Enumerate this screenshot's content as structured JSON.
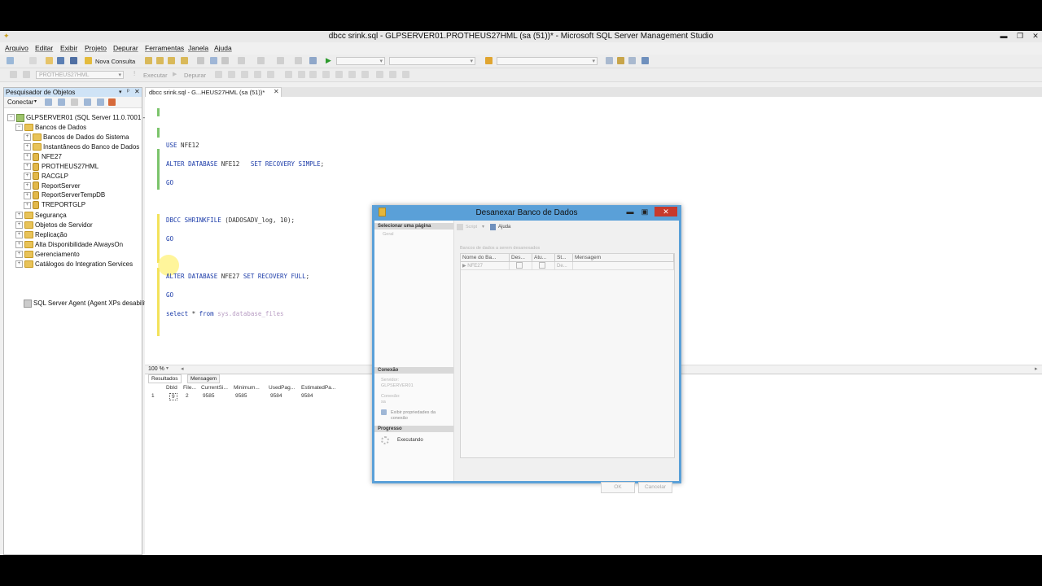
{
  "window": {
    "title": "dbcc srink.sql - GLPSERVER01.PROTHEUS27HML (sa (51))* - Microsoft SQL Server Management Studio"
  },
  "menu": [
    "Arquivo",
    "Editar",
    "Exibir",
    "Projeto",
    "Depurar",
    "Ferramentas",
    "Janela",
    "Ajuda"
  ],
  "toolbar": {
    "new_query": "Nova Consulta",
    "database_combo": "PROTHEUS27HML",
    "execute": "Executar",
    "debug": "Depurar"
  },
  "object_explorer": {
    "title": "Pesquisador de Objetos",
    "connect": "Conectar",
    "server": "GLPSERVER01 (SQL Server 11.0.7001 - sa)",
    "databases_folder": "Bancos de Dados",
    "items": [
      {
        "label": "Bancos de Dados do Sistema",
        "type": "folder"
      },
      {
        "label": "Instantâneos do Banco de Dados",
        "type": "folder"
      },
      {
        "label": "NFE27",
        "type": "db"
      },
      {
        "label": "PROTHEUS27HML",
        "type": "db"
      },
      {
        "label": "RACGLP",
        "type": "db"
      },
      {
        "label": "ReportServer",
        "type": "db"
      },
      {
        "label": "ReportServerTempDB",
        "type": "db"
      },
      {
        "label": "TREPORTGLP",
        "type": "db"
      }
    ],
    "root_items": [
      "Segurança",
      "Objetos de Servidor",
      "Replicação",
      "Alta Disponibilidade AlwaysOn",
      "Gerenciamento",
      "Catálogos do Integration Services"
    ],
    "agent": "SQL Server Agent (Agent XPs desabilit"
  },
  "document_tab": "dbcc srink.sql - G...HEUS27HML (sa (51))*",
  "editor": {
    "lines": {
      "use": [
        "USE",
        " NFE12"
      ],
      "alter1": [
        "ALTER DATABASE",
        " NFE12   ",
        "SET RECOVERY SIMPLE",
        ";"
      ],
      "go1": "GO",
      "dbcc": [
        "DBCC SHRINKFILE",
        " (DADOSADV_log, 10);"
      ],
      "go2": "GO",
      "alter2": [
        "ALTER DATABASE",
        " NFE27 ",
        "SET RECOVERY FULL",
        ";"
      ],
      "go3": "GO",
      "select": [
        "select",
        " * ",
        "from",
        " sys.database_files"
      ]
    }
  },
  "zoom": "100 %",
  "results": {
    "tabs": [
      "Resultados",
      "Mensagem"
    ],
    "columns": [
      "DbId",
      "File...",
      "CurrentSi...",
      "Minimum...",
      "UsedPag...",
      "EstimatedPa..."
    ],
    "rows": [
      [
        "1",
        "9",
        "2",
        "9585",
        "9585",
        "9584",
        "9584"
      ]
    ]
  },
  "dialog": {
    "title": "Desanexar Banco de Dados",
    "select_page": "Selecionar uma página",
    "page_general": "Geral",
    "script": "Script",
    "help": "Ajuda",
    "grid_caption": "Bancos de dados a serem desanexados",
    "grid_columns": [
      "Nome do Ba...",
      "Des...",
      "Atu...",
      "St...",
      "Mensagem"
    ],
    "grid_row": {
      "name": "NFE27",
      "status": "De..."
    },
    "connection_section": "Conexão",
    "server_label": "Servidor:",
    "server_value": "GLPSERVER01",
    "connection_label": "Conexão:",
    "connection_value": "sa",
    "view_connection": "Exibir propriedades da conexão",
    "progress_section": "Progresso",
    "progress_status": "Executando",
    "ok": "OK",
    "cancel": "Cancelar"
  }
}
